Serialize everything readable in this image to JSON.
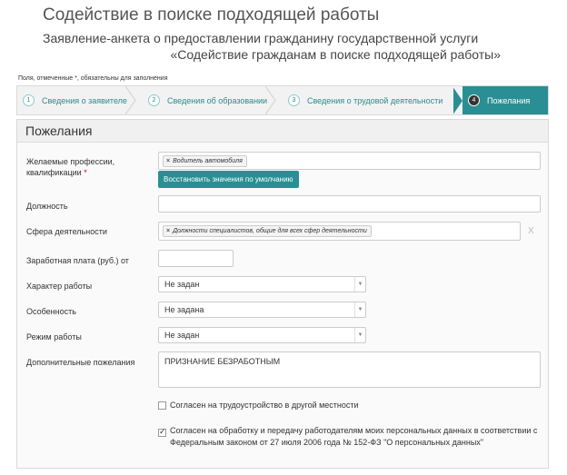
{
  "header": {
    "title": "Содействие в поиске подходящей работы",
    "subtitle_line1": "Заявление-анкета о предоставлении гражданину государственной услуги",
    "subtitle_line2": "«Содействие гражданам в поиске подходящей работы»"
  },
  "required_note": "Поля, отмеченные *, обязательны для заполнения",
  "steps": [
    {
      "num": "1",
      "label": "Сведения о заявителе"
    },
    {
      "num": "2",
      "label": "Сведения об образовании"
    },
    {
      "num": "3",
      "label": "Сведения о трудовой деятельности"
    },
    {
      "num": "4",
      "label": "Пожелания"
    }
  ],
  "panel": {
    "title": "Пожелания",
    "professions": {
      "label_line1": "Желаемые профессии,",
      "label_line2": "квалификации",
      "required_mark": "*",
      "tag": "Водитель автомобиля",
      "reset_button": "Восстановить значения по умолчанию"
    },
    "position": {
      "label": "Должность",
      "value": ""
    },
    "sphere": {
      "label": "Сфера деятельности",
      "tag": "Должности специалистов, общие для всех сфер деятельности",
      "clear": "X"
    },
    "salary": {
      "label": "Заработная плата (руб.) от",
      "value": ""
    },
    "work_nature": {
      "label": "Характер работы",
      "value": "Не задан"
    },
    "feature": {
      "label": "Особенность",
      "value": "Не задана"
    },
    "work_mode": {
      "label": "Режим работы",
      "value": "Не задан"
    },
    "additional": {
      "label": "Дополнительные пожелания",
      "value": "ПРИЗНАНИЕ БЕЗРАБОТНЫМ"
    },
    "agree_relocation": {
      "label": "Согласен на трудоустройство в другой местности",
      "checked": false
    },
    "agree_data": {
      "label_line1": "Согласен на обработку и передачу работодателям моих персональных данных в соответствии с",
      "label_line2": "Федеральным законом от 27 июля 2006 года № 152-ФЗ \"О персональных данных\"",
      "checked": true
    }
  },
  "colors": {
    "accent": "#2a8f94",
    "required": "#dd0000"
  }
}
